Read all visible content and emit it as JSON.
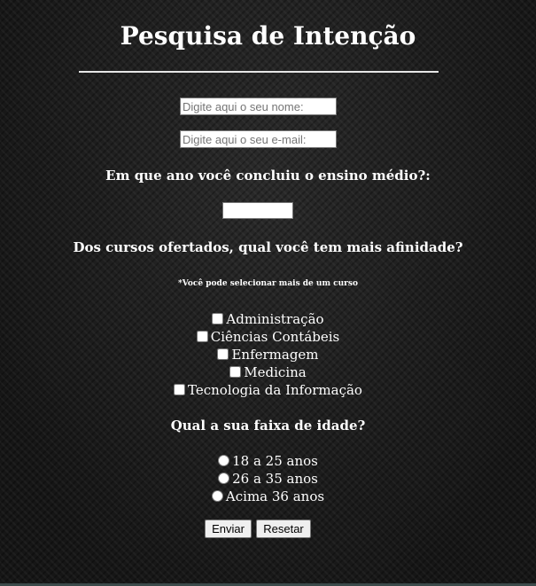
{
  "title": "Pesquisa de Intenção",
  "form": {
    "name_placeholder": "Digite aqui o seu nome:",
    "email_placeholder": "Digite aqui o seu e-mail:",
    "year_question": "Em que ano você concluiu o ensino médio?:",
    "year_value": "",
    "courses_question": "Dos cursos ofertados, qual você tem mais afinidade?",
    "courses_note": "*Você pode selecionar mais de um curso",
    "courses": [
      {
        "label": "Administração",
        "checked": false
      },
      {
        "label": "Ciências Contábeis",
        "checked": false
      },
      {
        "label": "Enfermagem",
        "checked": false
      },
      {
        "label": "Medicina",
        "checked": false
      },
      {
        "label": "Tecnologia da Informação",
        "checked": false
      }
    ],
    "age_question": "Qual a sua faixa de idade?",
    "age_options": [
      {
        "label": "18 a 25 anos",
        "checked": false
      },
      {
        "label": "26 a 35 anos",
        "checked": false
      },
      {
        "label": "Acima 36 anos",
        "checked": false
      }
    ],
    "submit_label": "Enviar",
    "reset_label": "Resetar"
  },
  "colors": {
    "background": "#1c1c1c",
    "text": "#ffffff",
    "divider": "#e6e6e6"
  }
}
